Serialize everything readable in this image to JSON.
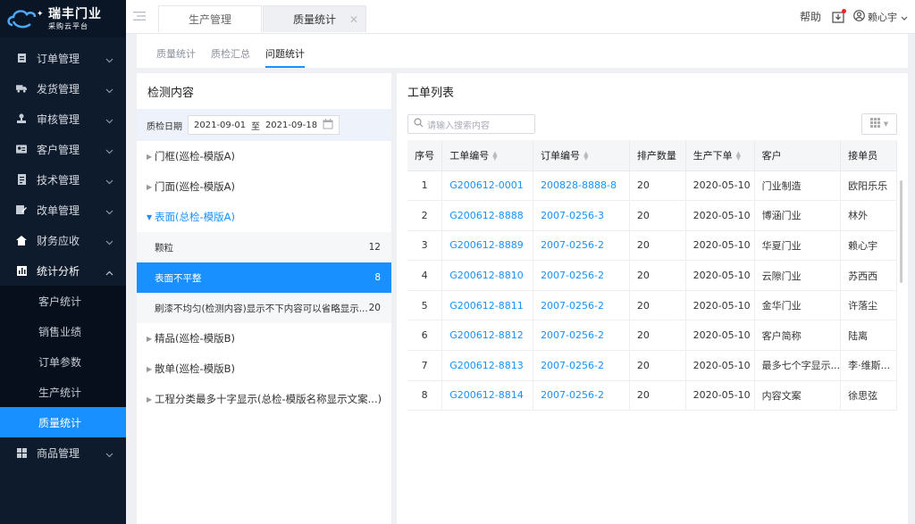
{
  "brand": {
    "title": "瑞丰门业",
    "subtitle": "采购云平台"
  },
  "sidebar": {
    "items": [
      {
        "label": "订单管理",
        "icon": "clipboard-icon"
      },
      {
        "label": "发货管理",
        "icon": "truck-icon"
      },
      {
        "label": "审核管理",
        "icon": "stamp-icon"
      },
      {
        "label": "客户管理",
        "icon": "id-card-icon"
      },
      {
        "label": "技术管理",
        "icon": "document-icon"
      },
      {
        "label": "改单管理",
        "icon": "edit-icon"
      },
      {
        "label": "财务应收",
        "icon": "home-icon"
      },
      {
        "label": "统计分析",
        "icon": "bar-chart-icon"
      }
    ],
    "sub_items": [
      "客户统计",
      "销售业绩",
      "订单参数",
      "生产统计",
      "质量统计"
    ],
    "last_item": {
      "label": "商品管理",
      "icon": "grid-icon"
    }
  },
  "topbar": {
    "tabs": [
      "生产管理",
      "质量统计"
    ],
    "help": "帮助",
    "user": "赖心宇"
  },
  "subtabs": [
    "质量统计",
    "质检汇总",
    "问题统计"
  ],
  "left_panel": {
    "title": "检测内容",
    "date_label": "质检日期",
    "date_start": "2021-09-01",
    "date_sep": "至",
    "date_end": "2021-09-18",
    "tree": [
      {
        "label": "门框(巡检-模版A)"
      },
      {
        "label": "门面(巡检-模版A)"
      },
      {
        "label": "表面(总检-模版A)"
      }
    ],
    "leaves": [
      {
        "label": "颗粒",
        "count": "12"
      },
      {
        "label": "表面不平整",
        "count": "8"
      },
      {
        "label": "刷漆不均匀(检测内容)显示不下内容可以省略显示...",
        "count": "20"
      }
    ],
    "tree_after": [
      {
        "label": "精品(巡检-模版B)"
      },
      {
        "label": "散单(巡检-模版B)"
      },
      {
        "label": "工程分类最多十字显示(总检-模版名称显示文案...)"
      }
    ]
  },
  "right_panel": {
    "title": "工单列表",
    "search_placeholder": "请输入搜索内容",
    "columns": [
      "序号",
      "工单编号",
      "订单编号",
      "排产数量",
      "生产下单",
      "客户",
      "接单员"
    ],
    "rows": [
      [
        "1",
        "G200612-0001",
        "200828-8888-8",
        "20",
        "2020-05-10",
        "门业制造",
        "欧阳乐乐"
      ],
      [
        "2",
        "G200612-8888",
        "2007-0256-3",
        "20",
        "2020-05-10",
        "博涵门业",
        "林外"
      ],
      [
        "3",
        "G200612-8889",
        "2007-0256-2",
        "20",
        "2020-05-10",
        "华夏门业",
        "赖心宇"
      ],
      [
        "4",
        "G200612-8810",
        "2007-0256-2",
        "20",
        "2020-05-10",
        "云隙门业",
        "苏西西"
      ],
      [
        "5",
        "G200612-8811",
        "2007-0256-2",
        "20",
        "2020-05-10",
        "金华门业",
        "许落尘"
      ],
      [
        "6",
        "G200612-8812",
        "2007-0256-2",
        "20",
        "2020-05-10",
        "客户简称",
        "陆离"
      ],
      [
        "7",
        "G200612-8813",
        "2007-0256-2",
        "20",
        "2020-05-10",
        "最多七个字显示...",
        "李·维斯..."
      ],
      [
        "8",
        "G200612-8814",
        "2007-0256-2",
        "20",
        "2020-05-10",
        "内容文案",
        "徐思弦"
      ]
    ]
  },
  "colors": {
    "accent": "#1890ff",
    "sidebar_bg": "#0e1b2c",
    "notification": "#f5222d"
  }
}
